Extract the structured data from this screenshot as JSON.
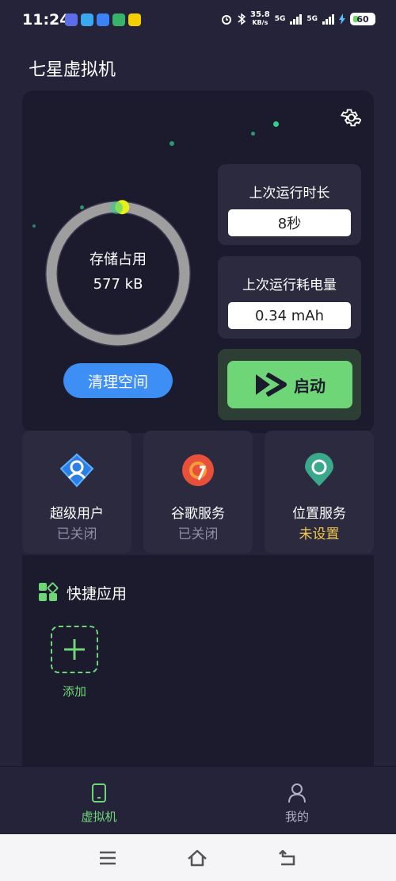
{
  "status_bar": {
    "time": "11:24",
    "net_speed_value": "35.8",
    "net_speed_unit": "KB/s",
    "signal1_label": "5G",
    "signal2_label": "5G",
    "battery_level": "60"
  },
  "app": {
    "title": "七星虚拟机"
  },
  "storage": {
    "label": "存储占用",
    "value": "577 kB",
    "usage_fraction": 0.01
  },
  "clean_button": {
    "label": "清理空间"
  },
  "last_run_duration": {
    "title": "上次运行时长",
    "value": "8秒"
  },
  "last_run_power": {
    "title": "上次运行耗电量",
    "value": "0.34 mAh"
  },
  "start_button": {
    "label": "启动"
  },
  "services": [
    {
      "title": "超级用户",
      "status": "已关闭",
      "status_color": "#8f8ca3",
      "icon": "superuser-icon"
    },
    {
      "title": "谷歌服务",
      "status": "已关闭",
      "status_color": "#8f8ca3",
      "icon": "google-services-icon"
    },
    {
      "title": "位置服务",
      "status": "未设置",
      "status_color": "#f2c94c",
      "icon": "location-icon"
    }
  ],
  "quick_apps": {
    "title": "快捷应用",
    "add_label": "添加"
  },
  "bottom_nav": {
    "items": [
      {
        "label": "虚拟机",
        "icon": "phone-icon",
        "active": true
      },
      {
        "label": "我的",
        "icon": "person-icon",
        "active": false
      }
    ]
  },
  "colors": {
    "accent_green": "#6ed677",
    "accent_blue": "#3d8ef5",
    "background": "#25233a",
    "card": "#1c1a2d"
  }
}
